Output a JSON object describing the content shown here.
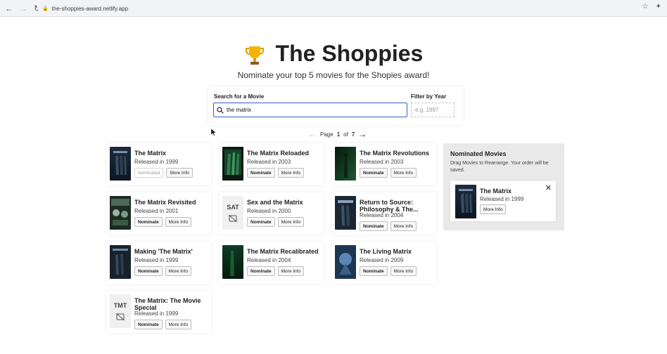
{
  "browser": {
    "url": "the-shoppies-award.netlify.app"
  },
  "header": {
    "title": "The Shoppies",
    "subtitle": "Nominate your top 5 movies for the Shopies award!"
  },
  "search": {
    "label": "Search for a Movie",
    "value": "the matrix",
    "year_label": "Filter by Year",
    "year_placeholder": "e.g. 1997"
  },
  "pagination": {
    "prefix": "Page",
    "current": "1",
    "of": "of",
    "total": "7"
  },
  "buttons": {
    "nominate": "Nominate",
    "nominated": "Nominated",
    "more_info": "More Info"
  },
  "movies": [
    {
      "title": "The Matrix",
      "year": "Released in 1999",
      "nominated": true
    },
    {
      "title": "The Matrix Reloaded",
      "year": "Released in 2003",
      "nominated": false
    },
    {
      "title": "The Matrix Revolutions",
      "year": "Released in 2003",
      "nominated": false
    },
    {
      "title": "The Matrix Revisited",
      "year": "Released in 2001",
      "nominated": false
    },
    {
      "title": "Sex and the Matrix",
      "year": "Released in 2000",
      "nominated": false,
      "placeholder": "SAT"
    },
    {
      "title": "Return to Source: Philosophy & The...",
      "year": "Released in 2004",
      "nominated": false
    },
    {
      "title": "Making 'The Matrix'",
      "year": "Released in 1999",
      "nominated": false
    },
    {
      "title": "The Matrix Recalibrated",
      "year": "Released in 2004",
      "nominated": false
    },
    {
      "title": "The Living Matrix",
      "year": "Released in 2009",
      "nominated": false
    },
    {
      "title": "The Matrix: The Movie Special",
      "year": "Released in 1999",
      "nominated": false,
      "placeholder": "TMT"
    }
  ],
  "nominations": {
    "title": "Nominated Movies",
    "description": "Drag Movies to Rearrange. Your order will be saved.",
    "items": [
      {
        "title": "The Matrix",
        "year": "Released in 1999"
      }
    ]
  },
  "colors": {
    "accent": "#3b5bd6",
    "panel": "#e9e9e9"
  }
}
